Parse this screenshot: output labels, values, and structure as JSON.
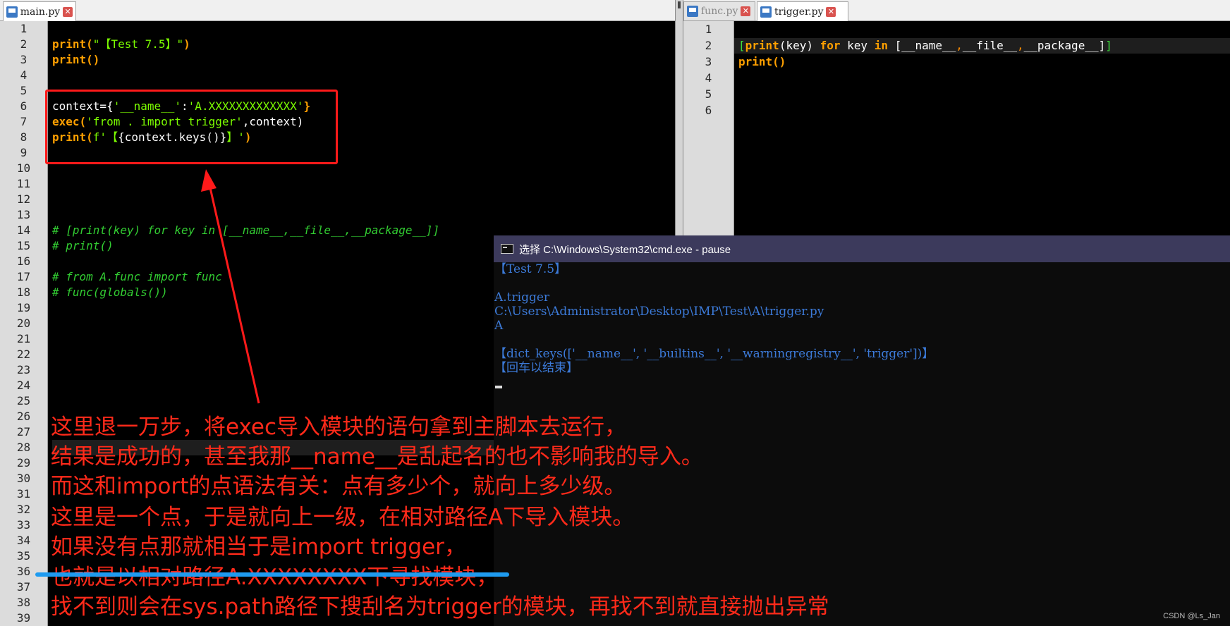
{
  "left_tabs": [
    {
      "label": "main.py",
      "active": true
    }
  ],
  "right_tabs": [
    {
      "label": "func.py",
      "active": false
    },
    {
      "label": "trigger.py",
      "active": true
    }
  ],
  "left_editor": {
    "line_numbers": [
      "1",
      "2",
      "3",
      "4",
      "5",
      "6",
      "7",
      "8",
      "9",
      "10",
      "11",
      "12",
      "13",
      "14",
      "15",
      "16",
      "17",
      "18",
      "19",
      "20",
      "21",
      "22",
      "23",
      "24",
      "25",
      "26",
      "27",
      "28",
      "29",
      "30",
      "31",
      "32",
      "33",
      "34",
      "35",
      "36",
      "37",
      "38",
      "39"
    ],
    "lines": {
      "l2a": "print(",
      "l2b": "\"【Test 7.5】\"",
      "l2c": ")",
      "l3": "print()",
      "l6a": "context={",
      "l6b": "'__name__'",
      "l6c": ":",
      "l6d": "'A.XXXXXXXXXXXXX'",
      "l6e": "}",
      "l7a": "exec(",
      "l7b": "'from . import trigger'",
      "l7c": ",context)",
      "l8a": "print(",
      "l8b": "f'【",
      "l8c": "{context.keys()}",
      "l8d": "】'",
      "l8e": ")",
      "l14": "# [print(key) for key in [__name__,__file__,__package__]]",
      "l15": "# print()",
      "l17": "# from A.func import func",
      "l18": "# func(globals())"
    }
  },
  "right_editor": {
    "line_numbers": [
      "1",
      "2",
      "3",
      "4",
      "5",
      "6"
    ],
    "lines": {
      "r2a": "[",
      "r2b": "print",
      "r2c": "(key) ",
      "r2d": "for",
      "r2e": " key ",
      "r2f": "in",
      "r2g": " [",
      "r2h": "__name__",
      "r2i": ",",
      "r2j": "__file__",
      "r2k": ",",
      "r2l": "__package__",
      "r2m": "]",
      "r2n": "]",
      "r3": "print()"
    }
  },
  "cmd_window": {
    "title": "选择 C:\\Windows\\System32\\cmd.exe - pause",
    "output": [
      "【Test 7.5】",
      "",
      "A.trigger",
      "C:\\Users\\Administrator\\Desktop\\IMP\\Test\\A\\trigger.py",
      "A",
      "",
      "【dict_keys(['__name__', '__builtins__', '__warningregistry__', 'trigger'])】",
      "【回车以结束】"
    ]
  },
  "annotations": [
    "这里退一万步，将exec导入模块的语句拿到主脚本去运行，",
    "结果是成功的，甚至我那__name__是乱起名的也不影响我的导入。",
    "而这和import的点语法有关：点有多少个，就向上多少级。",
    "这里是一个点，于是就向上一级，在相对路径A下导入模块。",
    "如果没有点那就相当于是import trigger，",
    "也就是以相对路径A.XXXXXXXX下寻找模块，",
    "找不到则会在sys.path路径下搜刮名为trigger的模块，再找不到就直接抛出异常"
  ],
  "watermark": "CSDN @Ls_Jan",
  "colors": {
    "annotation_red": "#ff2a1a",
    "highlight_blue": "#1e9bf0",
    "cmd_title_bg": "#3c3a5c",
    "cmd_text": "#3c7ad8"
  }
}
